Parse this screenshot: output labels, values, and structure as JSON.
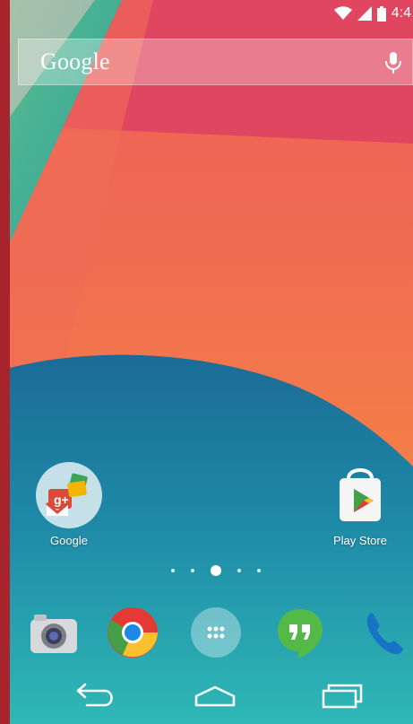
{
  "status_bar": {
    "time": "4:4",
    "icons": [
      "wifi-icon",
      "signal-icon",
      "battery-icon"
    ]
  },
  "search_bar": {
    "logo_text": "Google",
    "voice_icon": "mic-icon"
  },
  "home_apps": [
    {
      "label": "Google",
      "icon": "google-folder-icon"
    },
    {
      "label": "Play Store",
      "icon": "play-store-icon"
    }
  ],
  "page_indicator": {
    "count": 5,
    "active_index": 2
  },
  "dock": {
    "items": [
      {
        "icon": "camera-icon"
      },
      {
        "icon": "chrome-icon"
      },
      {
        "icon": "app-drawer-icon"
      },
      {
        "icon": "hangouts-icon"
      },
      {
        "icon": "phone-icon"
      }
    ]
  },
  "navigation": {
    "buttons": [
      "back-icon",
      "home-icon",
      "recent-apps-icon"
    ]
  },
  "colors": {
    "frame_border": "#a7242c",
    "wallpaper_red": "#e03d5b",
    "wallpaper_orange": "#f3774a",
    "wallpaper_teal": "#2aa9ad",
    "wallpaper_blue": "#1b6b96",
    "play_store_red": "#e53935",
    "play_store_green": "#43a047",
    "play_store_blue": "#1e88e5",
    "hangouts_green": "#55b948",
    "phone_blue": "#1773c4"
  }
}
